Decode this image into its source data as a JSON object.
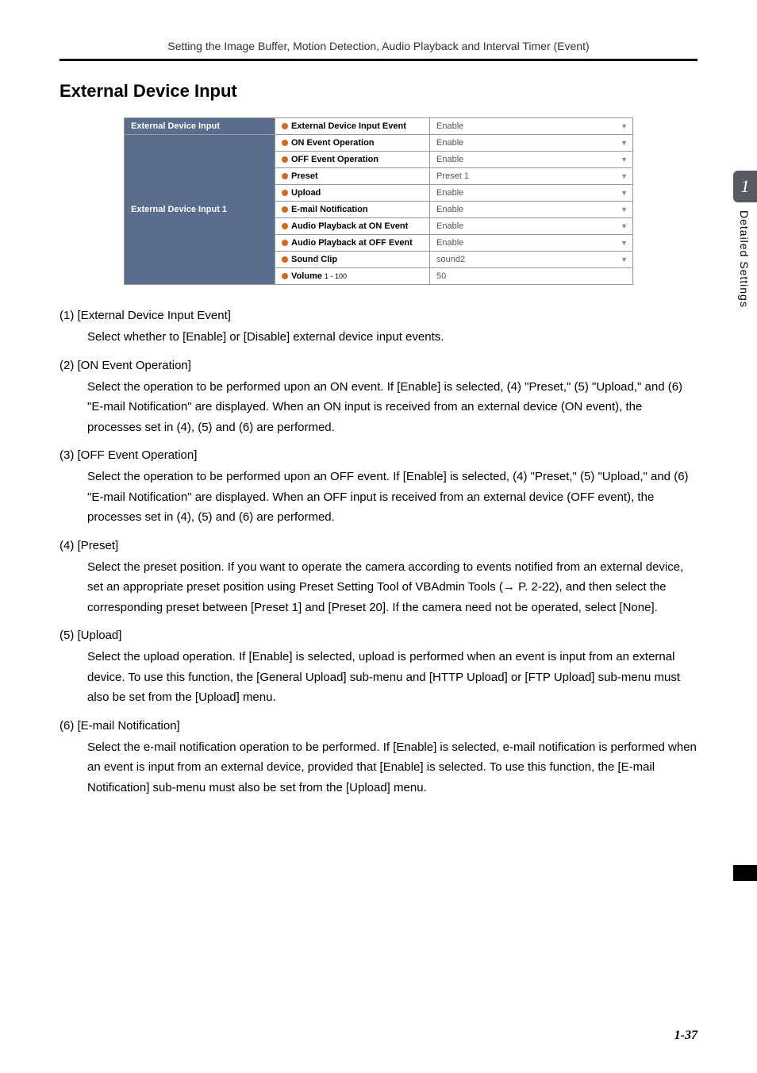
{
  "header": "Setting the Image Buffer, Motion Detection, Audio Playback and Interval Timer (Event)",
  "h2": "External Device Input",
  "table": {
    "group1": {
      "header": "External Device Input",
      "rows": [
        {
          "label": "External Device Input Event",
          "value": "Enable",
          "dropdown": true
        }
      ]
    },
    "group2": {
      "header": "External Device Input 1",
      "rows": [
        {
          "label": "ON Event Operation",
          "value": "Enable",
          "dropdown": true
        },
        {
          "label": "OFF Event Operation",
          "value": "Enable",
          "dropdown": true
        },
        {
          "label": "Preset",
          "value": "Preset 1",
          "dropdown": true
        },
        {
          "label": "Upload",
          "value": "Enable",
          "dropdown": true
        },
        {
          "label": "E-mail Notification",
          "value": "Enable",
          "dropdown": true
        },
        {
          "label": "Audio Playback at ON Event",
          "value": "Enable",
          "dropdown": true
        },
        {
          "label": "Audio Playback at OFF Event",
          "value": "Enable",
          "dropdown": true
        },
        {
          "label": "Sound Clip",
          "value": "sound2",
          "dropdown": true
        },
        {
          "label": "Volume",
          "range": "1 - 100",
          "value": "50",
          "dropdown": false
        }
      ]
    }
  },
  "sections": [
    {
      "num": "(1)",
      "title": "[External Device Input Event]",
      "body": "Select whether to [Enable] or [Disable] external device input events."
    },
    {
      "num": "(2)",
      "title": "[ON Event Operation]",
      "body": "Select the operation to be performed upon an ON event. If [Enable] is selected, (4) \"Preset,\" (5) \"Upload,\" and (6) \"E-mail Notification\" are displayed. When an ON input is received from an external device (ON event), the processes set in (4), (5) and (6) are performed."
    },
    {
      "num": "(3)",
      "title": "[OFF Event Operation]",
      "body": "Select the operation to be performed upon an OFF event. If [Enable] is selected, (4) \"Preset,\" (5) \"Upload,\" and (6) \"E-mail Notification\" are displayed. When an OFF input is received from an external device (OFF event), the processes set in (4), (5) and (6) are performed."
    },
    {
      "num": "(4)",
      "title": "[Preset]",
      "body": "Select the preset position. If you want to operate the camera according to events notified from an external device, set an appropriate preset position using Preset Setting Tool of VBAdmin Tools (→ P. 2-22), and then select the corresponding preset between [Preset 1] and [Preset 20]. If the camera need not be operated, select [None]."
    },
    {
      "num": "(5)",
      "title": "[Upload]",
      "body": "Select the upload operation. If [Enable] is selected, upload is performed when an event is input from an external device. To use this function, the [General Upload] sub-menu and [HTTP Upload] or [FTP Upload] sub-menu must also be set from the [Upload] menu."
    },
    {
      "num": "(6)",
      "title": "[E-mail Notification]",
      "body": "Select the e-mail notification operation to be performed. If [Enable] is selected, e-mail notification is performed when an event is input from an external device, provided that [Enable] is selected. To use this function, the [E-mail Notification] sub-menu must also be set from the [Upload] menu."
    }
  ],
  "side": {
    "chapter": "1",
    "label": "Detailed Settings"
  },
  "page_num": "1-37"
}
